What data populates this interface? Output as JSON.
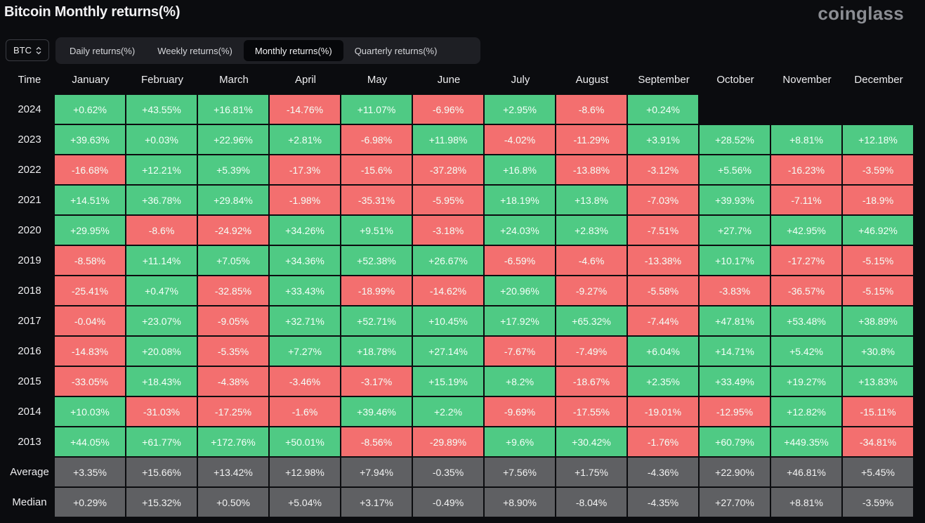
{
  "header": {
    "title": "Bitcoin Monthly returns(%)",
    "brand": "coinglass"
  },
  "asset_selector": {
    "value": "BTC",
    "icon": "chevron-up-down-icon"
  },
  "tabs": [
    {
      "label": "Daily returns(%)",
      "active": false
    },
    {
      "label": "Weekly returns(%)",
      "active": false
    },
    {
      "label": "Monthly returns(%)",
      "active": true
    },
    {
      "label": "Quarterly returns(%)",
      "active": false
    }
  ],
  "colors": {
    "positive": "#4fca84",
    "negative": "#f36f6f",
    "summary": "#5f6063",
    "background": "#0b0c0f"
  },
  "chart_data": {
    "type": "table",
    "title": "Bitcoin Monthly returns(%)",
    "row_header_label": "Time",
    "columns": [
      "January",
      "February",
      "March",
      "April",
      "May",
      "June",
      "July",
      "August",
      "September",
      "October",
      "November",
      "December"
    ],
    "rows": [
      {
        "label": "2024",
        "values": [
          "+0.62%",
          "+43.55%",
          "+16.81%",
          "-14.76%",
          "+11.07%",
          "-6.96%",
          "+2.95%",
          "-8.6%",
          "+0.24%",
          null,
          null,
          null
        ]
      },
      {
        "label": "2023",
        "values": [
          "+39.63%",
          "+0.03%",
          "+22.96%",
          "+2.81%",
          "-6.98%",
          "+11.98%",
          "-4.02%",
          "-11.29%",
          "+3.91%",
          "+28.52%",
          "+8.81%",
          "+12.18%"
        ]
      },
      {
        "label": "2022",
        "values": [
          "-16.68%",
          "+12.21%",
          "+5.39%",
          "-17.3%",
          "-15.6%",
          "-37.28%",
          "+16.8%",
          "-13.88%",
          "-3.12%",
          "+5.56%",
          "-16.23%",
          "-3.59%"
        ]
      },
      {
        "label": "2021",
        "values": [
          "+14.51%",
          "+36.78%",
          "+29.84%",
          "-1.98%",
          "-35.31%",
          "-5.95%",
          "+18.19%",
          "+13.8%",
          "-7.03%",
          "+39.93%",
          "-7.11%",
          "-18.9%"
        ]
      },
      {
        "label": "2020",
        "values": [
          "+29.95%",
          "-8.6%",
          "-24.92%",
          "+34.26%",
          "+9.51%",
          "-3.18%",
          "+24.03%",
          "+2.83%",
          "-7.51%",
          "+27.7%",
          "+42.95%",
          "+46.92%"
        ]
      },
      {
        "label": "2019",
        "values": [
          "-8.58%",
          "+11.14%",
          "+7.05%",
          "+34.36%",
          "+52.38%",
          "+26.67%",
          "-6.59%",
          "-4.6%",
          "-13.38%",
          "+10.17%",
          "-17.27%",
          "-5.15%"
        ]
      },
      {
        "label": "2018",
        "values": [
          "-25.41%",
          "+0.47%",
          "-32.85%",
          "+33.43%",
          "-18.99%",
          "-14.62%",
          "+20.96%",
          "-9.27%",
          "-5.58%",
          "-3.83%",
          "-36.57%",
          "-5.15%"
        ]
      },
      {
        "label": "2017",
        "values": [
          "-0.04%",
          "+23.07%",
          "-9.05%",
          "+32.71%",
          "+52.71%",
          "+10.45%",
          "+17.92%",
          "+65.32%",
          "-7.44%",
          "+47.81%",
          "+53.48%",
          "+38.89%"
        ]
      },
      {
        "label": "2016",
        "values": [
          "-14.83%",
          "+20.08%",
          "-5.35%",
          "+7.27%",
          "+18.78%",
          "+27.14%",
          "-7.67%",
          "-7.49%",
          "+6.04%",
          "+14.71%",
          "+5.42%",
          "+30.8%"
        ]
      },
      {
        "label": "2015",
        "values": [
          "-33.05%",
          "+18.43%",
          "-4.38%",
          "-3.46%",
          "-3.17%",
          "+15.19%",
          "+8.2%",
          "-18.67%",
          "+2.35%",
          "+33.49%",
          "+19.27%",
          "+13.83%"
        ]
      },
      {
        "label": "2014",
        "values": [
          "+10.03%",
          "-31.03%",
          "-17.25%",
          "-1.6%",
          "+39.46%",
          "+2.2%",
          "-9.69%",
          "-17.55%",
          "-19.01%",
          "-12.95%",
          "+12.82%",
          "-15.11%"
        ]
      },
      {
        "label": "2013",
        "values": [
          "+44.05%",
          "+61.77%",
          "+172.76%",
          "+50.01%",
          "-8.56%",
          "-29.89%",
          "+9.6%",
          "+30.42%",
          "-1.76%",
          "+60.79%",
          "+449.35%",
          "-34.81%"
        ]
      }
    ],
    "summary_rows": [
      {
        "label": "Average",
        "values": [
          "+3.35%",
          "+15.66%",
          "+13.42%",
          "+12.98%",
          "+7.94%",
          "-0.35%",
          "+7.56%",
          "+1.75%",
          "-4.36%",
          "+22.90%",
          "+46.81%",
          "+5.45%"
        ]
      },
      {
        "label": "Median",
        "values": [
          "+0.29%",
          "+15.32%",
          "+0.50%",
          "+5.04%",
          "+3.17%",
          "-0.49%",
          "+8.90%",
          "-8.04%",
          "-4.35%",
          "+27.70%",
          "+8.81%",
          "-3.59%"
        ]
      }
    ]
  }
}
